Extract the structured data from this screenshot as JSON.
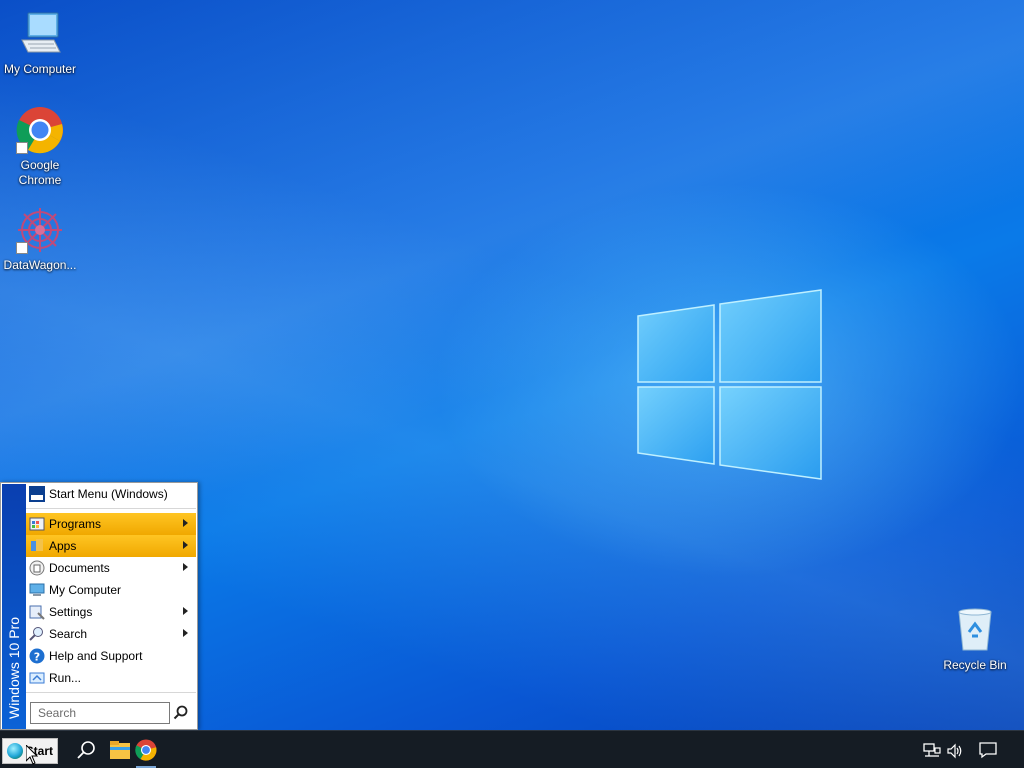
{
  "desktop": {
    "icons": [
      {
        "label": "My Computer",
        "icon": "computer-icon"
      },
      {
        "label": "Google Chrome",
        "icon": "chrome-icon",
        "shortcut": true
      },
      {
        "label": "DataWagon...",
        "icon": "datawagon-icon",
        "shortcut": true
      },
      {
        "label": "Recycle Bin",
        "icon": "recycle-bin-icon"
      }
    ]
  },
  "start_menu": {
    "banner": "Windows 10 Pro",
    "items": [
      {
        "label": "Start Menu (Windows)",
        "icon": "start-menu-icon",
        "submenu": false,
        "highlighted": false
      },
      {
        "label": "Programs",
        "icon": "programs-icon",
        "submenu": true,
        "highlighted": true
      },
      {
        "label": "Apps",
        "icon": "apps-icon",
        "submenu": true,
        "highlighted": true
      },
      {
        "label": "Documents",
        "icon": "documents-icon",
        "submenu": true,
        "highlighted": false
      },
      {
        "label": "My Computer",
        "icon": "computer-icon",
        "submenu": false,
        "highlighted": false
      },
      {
        "label": "Settings",
        "icon": "settings-icon",
        "submenu": true,
        "highlighted": false
      },
      {
        "label": "Search",
        "icon": "search-icon",
        "submenu": true,
        "highlighted": false
      },
      {
        "label": "Help and Support",
        "icon": "help-icon",
        "submenu": false,
        "highlighted": false
      },
      {
        "label": "Run...",
        "icon": "run-icon",
        "submenu": false,
        "highlighted": false
      }
    ],
    "search": {
      "placeholder": "Search"
    }
  },
  "taskbar": {
    "start_label": "Start",
    "pinned": [
      "search-icon",
      "file-explorer-icon",
      "chrome-icon"
    ],
    "tray": [
      "network-icon",
      "volume-icon",
      "notification-icon"
    ]
  },
  "colors": {
    "highlight": "#f6b800",
    "banner": "#0b4fc0",
    "taskbar": "#151c24"
  }
}
